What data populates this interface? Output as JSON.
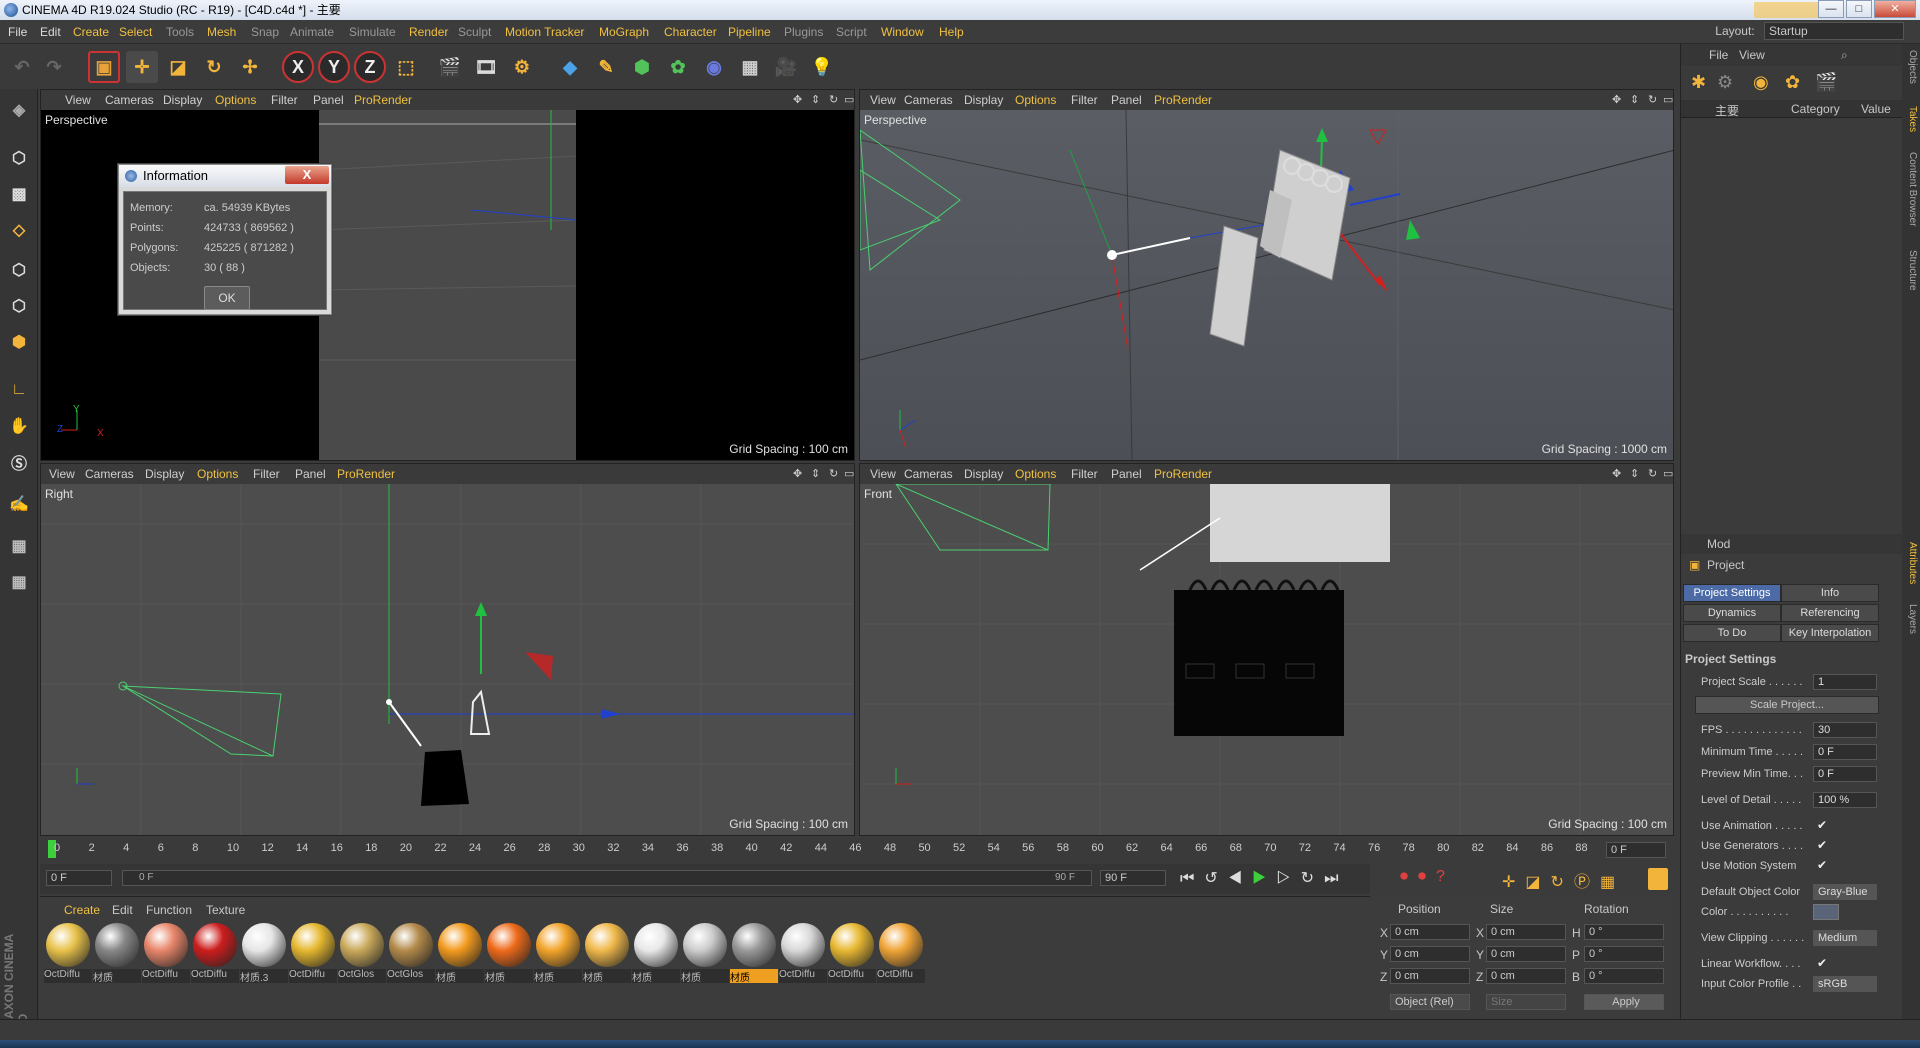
{
  "window": {
    "title": "CINEMA 4D R19.024 Studio (RC - R19) - [C4D.c4d *] - 主要",
    "controls": [
      "—",
      "□",
      "✕"
    ]
  },
  "menu": [
    "File",
    "Edit",
    "Create",
    "Select",
    "Tools",
    "Mesh",
    "Snap",
    "Animate",
    "Simulate",
    "Render",
    "Sculpt",
    "Motion Tracker",
    "MoGraph",
    "Character",
    "Pipeline",
    "Plugins",
    "Script",
    "Window",
    "Help"
  ],
  "layout": {
    "label": "Layout:",
    "value": "Startup"
  },
  "viewport_menu": {
    "view": "View",
    "cameras": "Cameras",
    "display": "Display",
    "options": "Options",
    "filter": "Filter",
    "panel": "Panel",
    "prorender": "ProRender"
  },
  "viewports": [
    {
      "name": "Perspective",
      "grid": "Grid Spacing : 100 cm"
    },
    {
      "name": "Perspective",
      "grid": "Grid Spacing : 1000 cm"
    },
    {
      "name": "Right",
      "grid": "Grid Spacing : 100 cm"
    },
    {
      "name": "Front",
      "grid": "Grid Spacing : 100 cm"
    }
  ],
  "info_dialog": {
    "title": "Information",
    "close": "X",
    "memory_label": "Memory:",
    "memory_value": "ca. 54939 KBytes",
    "points_label": "Points:",
    "points_value": "424733 ( 869562 )",
    "polygons_label": "Polygons:",
    "polygons_value": "425225 ( 871282 )",
    "objects_label": "Objects:",
    "objects_value": "30 ( 88 )",
    "ok": "OK"
  },
  "timeline": {
    "ticks": [
      "0",
      "2",
      "4",
      "6",
      "8",
      "10",
      "12",
      "14",
      "16",
      "18",
      "20",
      "22",
      "24",
      "26",
      "28",
      "30",
      "32",
      "34",
      "36",
      "38",
      "40",
      "42",
      "44",
      "46",
      "48",
      "50",
      "52",
      "54",
      "56",
      "58",
      "60",
      "62",
      "64",
      "66",
      "68",
      "70",
      "72",
      "74",
      "76",
      "78",
      "80",
      "82",
      "84",
      "86",
      "88",
      "90"
    ],
    "current_frame": "0 F",
    "start": "0 F",
    "range_start": "0 F",
    "range_end": "90 F",
    "end": "90 F"
  },
  "material_menu": {
    "create": "Create",
    "edit": "Edit",
    "function": "Function",
    "texture": "Texture"
  },
  "materials": [
    {
      "label": "OctDiffu",
      "color": "#e8c24a"
    },
    {
      "label": "材质",
      "color": "#888888"
    },
    {
      "label": "OctDiffu",
      "color": "#e8866a"
    },
    {
      "label": "OctDiffu",
      "color": "#cc1d1d"
    },
    {
      "label": "材质.3",
      "color": "#e6e6e6"
    },
    {
      "label": "OctDiffu",
      "color": "#e6b830"
    },
    {
      "label": "OctGlos",
      "color": "#c9a85a"
    },
    {
      "label": "OctGlos",
      "color": "#b38a4a"
    },
    {
      "label": "材质",
      "color": "#f29a1e"
    },
    {
      "label": "材质",
      "color": "#ee6a1a"
    },
    {
      "label": "材质",
      "color": "#f2a42a"
    },
    {
      "label": "材质",
      "color": "#f0b84a"
    },
    {
      "label": "材质",
      "color": "#e8e8e8"
    },
    {
      "label": "材质",
      "color": "#cccccc"
    },
    {
      "label": "材质",
      "color": "#9a9a9a"
    },
    {
      "label": "OctDiffu",
      "color": "#d8d8d8"
    },
    {
      "label": "OctDiffu",
      "color": "#e8b832"
    },
    {
      "label": "OctDiffu",
      "color": "#efa436"
    }
  ],
  "coords": {
    "position": "Position",
    "size": "Size",
    "rotation": "Rotation",
    "x": "X",
    "y": "Y",
    "z": "Z",
    "h": "H",
    "p": "P",
    "b": "B",
    "px": "0 cm",
    "py": "0 cm",
    "pz": "0 cm",
    "sx": "0 cm",
    "sy": "0 cm",
    "sz": "0 cm",
    "rh": "0 °",
    "rp": "0 °",
    "rb": "0 °",
    "mode": "Object (Rel)",
    "size_mode": "Size",
    "apply": "Apply"
  },
  "objects_panel": {
    "file": "File",
    "view": "View",
    "root": "主要",
    "category": "Category",
    "value": "Value"
  },
  "attributes": {
    "mode": "Mod",
    "project": "Project",
    "tabs": [
      "Project Settings",
      "Info",
      "Dynamics",
      "Referencing",
      "To Do",
      "Key Interpolation"
    ],
    "section": "Project Settings",
    "project_scale_label": "Project Scale . . . . . .",
    "project_scale": "1",
    "scale_project": "Scale Project...",
    "fps_label": "FPS . . . . . . . . . . . . .",
    "fps": "30",
    "min_time_label": "Minimum Time . . . . .",
    "min_time": "0 F",
    "preview_min_label": "Preview Min Time. . .",
    "preview_min": "0 F",
    "lod_label": "Level of Detail . . . . .",
    "lod": "100 %",
    "use_anim": "Use Animation . . . . .",
    "use_gen": "Use Generators . . . .",
    "use_motion": "Use Motion System",
    "default_color_label": "Default Object Color",
    "default_color": "Gray-Blue",
    "color_label": "Color . . . . . . . . . .",
    "view_clipping_label": "View Clipping . . . . . .",
    "view_clipping": "Medium",
    "linear_workflow": "Linear Workflow. . . .",
    "input_color_label": "Input Color Profile . .",
    "input_color": "sRGB",
    "check": "✔"
  },
  "side_tabs": [
    "Objects",
    "Takes",
    "Content Browser",
    "Structure",
    "Attributes",
    "Layers"
  ],
  "maxon_logo": "MAXON CINEMA 4D",
  "colors": {
    "accent": "#f0c040",
    "selected_tab": "#4b6aa6",
    "axis_x": "#d02020",
    "axis_y": "#20c040",
    "axis_z": "#2040d0"
  }
}
